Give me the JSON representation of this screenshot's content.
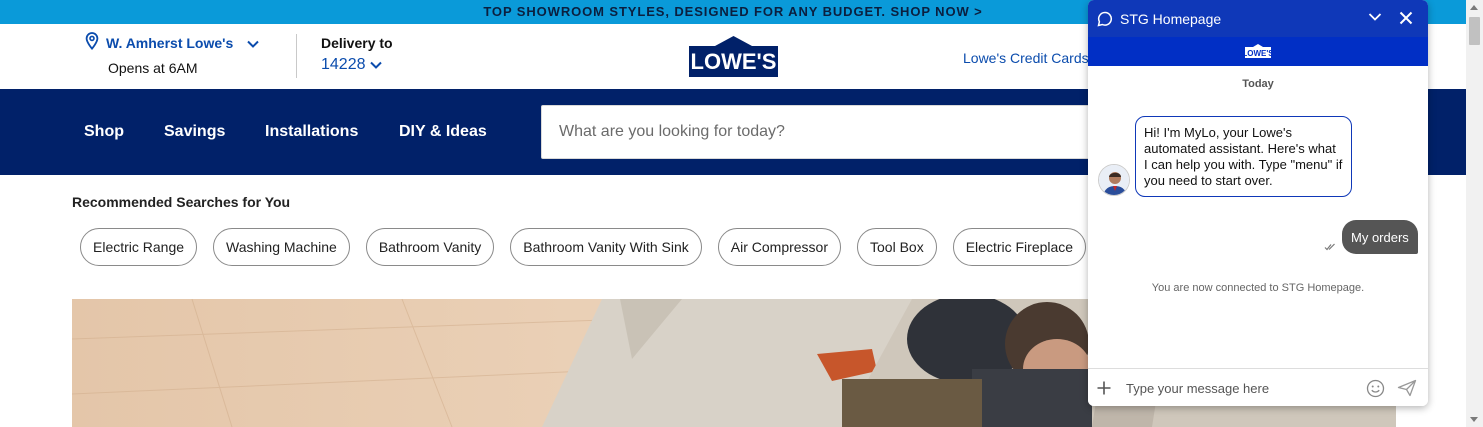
{
  "promo": {
    "text": "TOP SHOWROOM STYLES, DESIGNED FOR ANY BUDGET. SHOP NOW >"
  },
  "header": {
    "store_name": "W. Amherst Lowe's",
    "store_hours": "Opens at 6AM",
    "delivery_label": "Delivery to",
    "delivery_zip": "14228",
    "logo_text": "LOWE'S",
    "credit_link": "Lowe's Credit Cards"
  },
  "nav": {
    "items": [
      {
        "label": "Shop"
      },
      {
        "label": "Savings"
      },
      {
        "label": "Installations"
      },
      {
        "label": "DIY & Ideas"
      }
    ],
    "search_placeholder": "What are you looking for today?"
  },
  "recommended": {
    "title": "Recommended Searches for You",
    "chips": [
      "Electric Range",
      "Washing Machine",
      "Bathroom Vanity",
      "Bathroom Vanity With Sink",
      "Air Compressor",
      "Tool Box",
      "Electric Fireplace"
    ]
  },
  "chat": {
    "title": "STG Homepage",
    "logo_text": "LOWE'S",
    "date_label": "Today",
    "bot_message": "Hi! I'm MyLo, your Lowe's automated assistant. Here's what I can help you with. Type \"menu\" if you need to start over.",
    "user_message": "My orders",
    "system_message": "You are now connected to STG Homepage.",
    "input_placeholder": "Type your message here"
  },
  "colors": {
    "promo_bg": "#0a9ad9",
    "nav_bg": "#012169",
    "link_blue": "#0b4cad",
    "chat_header": "#0f38b8",
    "user_bubble": "#555555"
  }
}
